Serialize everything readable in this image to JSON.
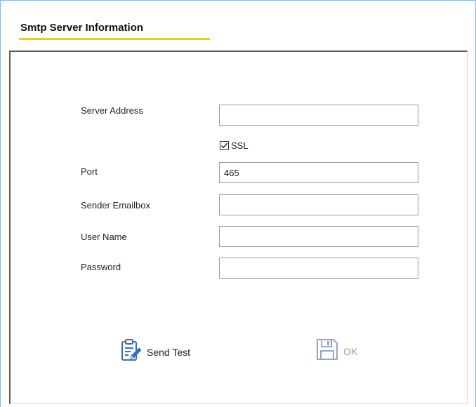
{
  "header": {
    "title": "Smtp Server Information"
  },
  "form": {
    "server_address": {
      "label": "Server Address",
      "value": ""
    },
    "ssl": {
      "label": "SSL",
      "checked": true
    },
    "port": {
      "label": "Port",
      "value": "465"
    },
    "sender_emailbox": {
      "label": "Sender Emailbox",
      "value": ""
    },
    "user_name": {
      "label": "User Name",
      "value": ""
    },
    "password": {
      "label": "Password",
      "value": ""
    }
  },
  "actions": {
    "send_test": {
      "label": "Send Test",
      "icon": "edit-document-icon"
    },
    "ok": {
      "label": "OK",
      "icon": "save-disk-icon",
      "enabled": false
    }
  },
  "colors": {
    "accent_underline": "#f5c518",
    "window_border": "#8fb7e6",
    "icon_blue": "#2f6fc4",
    "disabled_gray": "#9a9a9a"
  }
}
